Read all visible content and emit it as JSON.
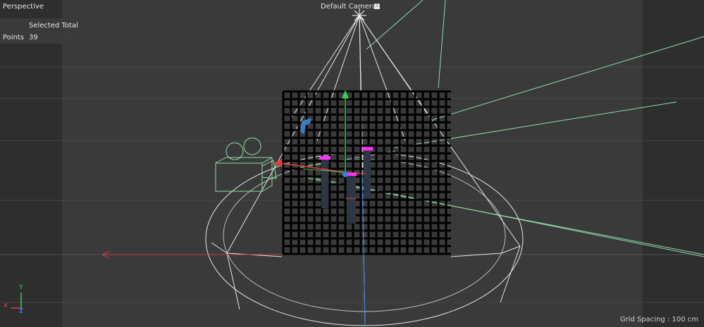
{
  "viewport": {
    "view_name": "Perspective",
    "camera_label": "Default Camera",
    "camera_icon": "camera-switch-icon",
    "grid_spacing": "Grid Spacing : 100 cm"
  },
  "selection_info": {
    "header": "Selected Total",
    "rows": [
      {
        "label": "Points",
        "value": "39"
      }
    ]
  },
  "axes": {
    "y": "Y",
    "x": "X",
    "z": "Z"
  },
  "colors": {
    "background": "#3a3a3a",
    "side_band": "#2e2e2e",
    "grid_line": "#454545",
    "wireframe_white": "#e6e6e6",
    "spline_green": "#8fdcaa",
    "axis_red": "#e04040",
    "axis_green": "#3ccc5a",
    "axis_blue": "#3c7ce8",
    "magenta": "#ff33ff",
    "mesh_black": "#000000"
  }
}
